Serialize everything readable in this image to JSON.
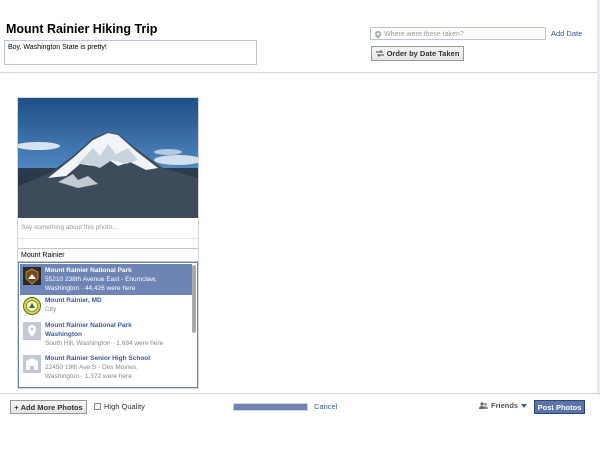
{
  "album": {
    "title": "Mount Rainier Hiking Trip",
    "description": "Boy, Washington State is pretty!"
  },
  "location": {
    "placeholder": "Where were these taken?",
    "icon": "map-pin-icon",
    "add_date_label": "Add Date"
  },
  "order_button": {
    "label": "Order by Date Taken",
    "icon": "sort-arrows-icon"
  },
  "photo": {
    "caption_placeholder": "Say something about this photo...",
    "location_value": "Mount Rainier"
  },
  "suggestions": [
    {
      "title": "Mount Rainier National Park",
      "line1": "55210 238th Avenue East - Enumclaw,",
      "line2": "Washington · 44,426 were here",
      "icon": "park-badge-icon",
      "selected": true
    },
    {
      "title": "Mount Rainier, MD",
      "line1": "City",
      "line2": "",
      "icon": "city-seal-icon",
      "selected": false
    },
    {
      "title": "Mount Rainier National Park",
      "line1": "Washington",
      "line2": "South Hill, Washington · 1,684 were here",
      "icon": "place-pin-icon",
      "selected": false,
      "title_lines": 2
    },
    {
      "title": "Mount Rainier Senior High School",
      "line1": "22450 19th Ave S - Des Moines,",
      "line2": "Washington · 1,372 were here",
      "icon": "school-icon",
      "selected": false
    }
  ],
  "footer": {
    "add_more_label": "Add More Photos",
    "high_quality_label": "High Quality",
    "cancel_label": "Cancel",
    "friends_label": "Friends",
    "post_label": "Post Photos",
    "upload_progress": 1.0
  },
  "colors": {
    "accent": "#3b5998",
    "selection": "#6d84b4",
    "primary_button": "#5b74a8"
  }
}
